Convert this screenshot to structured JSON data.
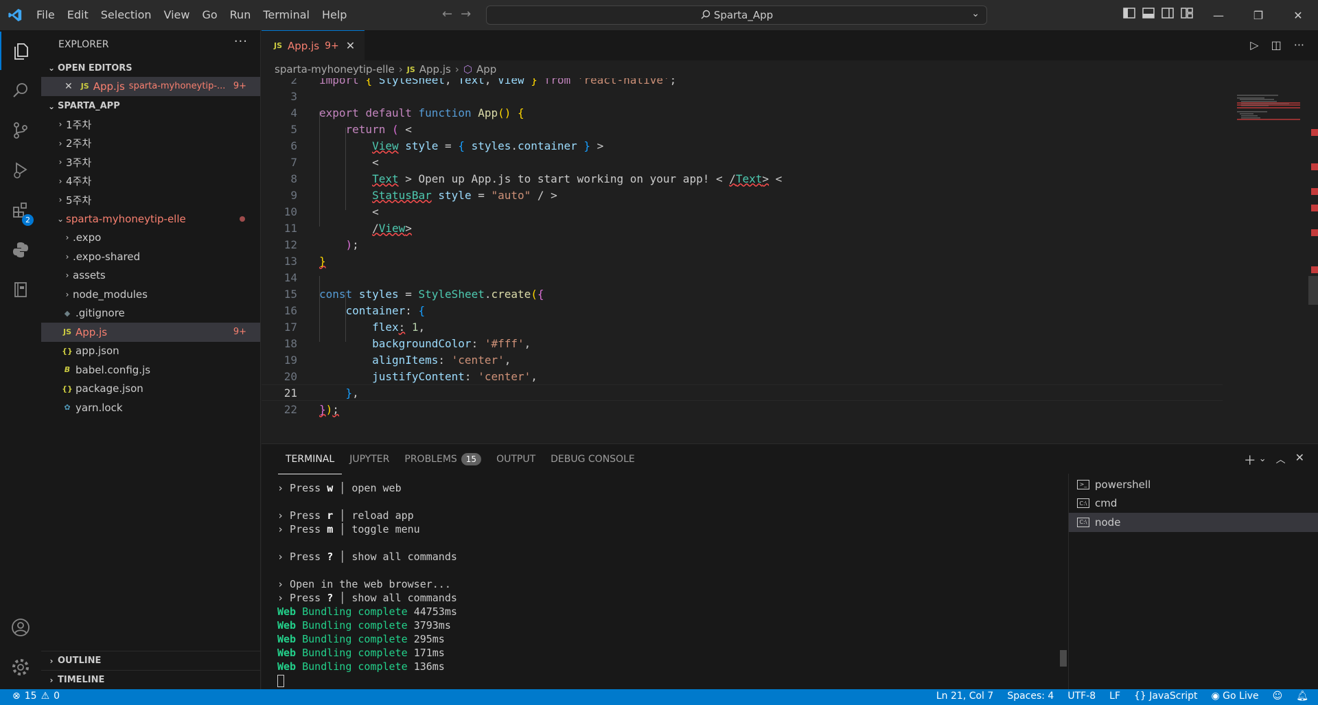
{
  "titlebar": {
    "menu": [
      "File",
      "Edit",
      "Selection",
      "View",
      "Go",
      "Run",
      "Terminal",
      "Help"
    ],
    "search": "Sparta_App"
  },
  "activity": {
    "extensions_badge": "2"
  },
  "sidebar": {
    "title": "EXPLORER",
    "open_editors_label": "OPEN EDITORS",
    "open_editor": {
      "name": "App.js",
      "path": "sparta-myhoneytip-...",
      "count": "9+"
    },
    "workspace_label": "SPARTA_APP",
    "folders": [
      "1주차",
      "2주차",
      "3주차",
      "4주차",
      "5주차"
    ],
    "project": {
      "name": "sparta-myhoneytip-elle"
    },
    "project_items": [
      {
        "name": ".expo",
        "kind": "folder"
      },
      {
        "name": ".expo-shared",
        "kind": "folder"
      },
      {
        "name": "assets",
        "kind": "folder"
      },
      {
        "name": "node_modules",
        "kind": "folder"
      },
      {
        "name": ".gitignore",
        "kind": "file",
        "icon": "git-icon"
      },
      {
        "name": "App.js",
        "kind": "file",
        "icon": "js-icon",
        "count": "9+",
        "selected": true
      },
      {
        "name": "app.json",
        "kind": "file",
        "icon": "json-icon"
      },
      {
        "name": "babel.config.js",
        "kind": "file",
        "icon": "babel-icon"
      },
      {
        "name": "package.json",
        "kind": "file",
        "icon": "json-icon"
      },
      {
        "name": "yarn.lock",
        "kind": "file",
        "icon": "yarn-icon"
      }
    ],
    "outline_label": "OUTLINE",
    "timeline_label": "TIMELINE"
  },
  "editor": {
    "tab": {
      "name": "App.js",
      "count": "9+"
    },
    "breadcrumb": [
      "sparta-myhoneytip-elle",
      "App.js",
      "App"
    ],
    "line_numbers": [
      "2",
      "3",
      "4",
      "5",
      "6",
      "7",
      "8",
      "9",
      "10",
      "11",
      "12",
      "13",
      "14",
      "15",
      "16",
      "17",
      "18",
      "19",
      "20",
      "21",
      "22"
    ],
    "current_line": "21"
  },
  "panel": {
    "tabs": [
      "TERMINAL",
      "JUPYTER",
      "PROBLEMS",
      "OUTPUT",
      "DEBUG CONSOLE"
    ],
    "problems_count": "15",
    "terminal_lines": [
      {
        "pre": "› Press ",
        "key": "w",
        "post": " │ open web"
      },
      {
        "pre": "",
        "key": "",
        "post": ""
      },
      {
        "pre": "› Press ",
        "key": "r",
        "post": " │ reload app"
      },
      {
        "pre": "› Press ",
        "key": "m",
        "post": " │ toggle menu"
      },
      {
        "pre": "",
        "key": "",
        "post": ""
      },
      {
        "pre": "› Press ",
        "key": "?",
        "post": " │ show all commands"
      },
      {
        "pre": "",
        "key": "",
        "post": ""
      },
      {
        "pre": "› Open in the web browser...",
        "key": "",
        "post": ""
      },
      {
        "pre": "› Press ",
        "key": "?",
        "post": " │ show all commands"
      }
    ],
    "bundling": [
      {
        "label": "Web",
        "text": "Bundling complete",
        "time": "44753ms"
      },
      {
        "label": "Web",
        "text": "Bundling complete",
        "time": "3793ms"
      },
      {
        "label": "Web",
        "text": "Bundling complete",
        "time": "295ms"
      },
      {
        "label": "Web",
        "text": "Bundling complete",
        "time": "171ms"
      },
      {
        "label": "Web",
        "text": "Bundling complete",
        "time": "136ms"
      }
    ],
    "terminals": [
      {
        "name": "powershell",
        "icon": "powershell-icon"
      },
      {
        "name": "cmd",
        "icon": "cmd-icon"
      },
      {
        "name": "node",
        "icon": "cmd-icon",
        "selected": true
      }
    ]
  },
  "statusbar": {
    "errors": "15",
    "warnings": "0",
    "position": "Ln 21, Col 7",
    "spaces": "Spaces: 4",
    "encoding": "UTF-8",
    "eol": "LF",
    "language": "JavaScript",
    "golive": "Go Live"
  },
  "colors": {
    "accent": "#0078d4",
    "status": "#007acc",
    "error": "#f88070"
  }
}
